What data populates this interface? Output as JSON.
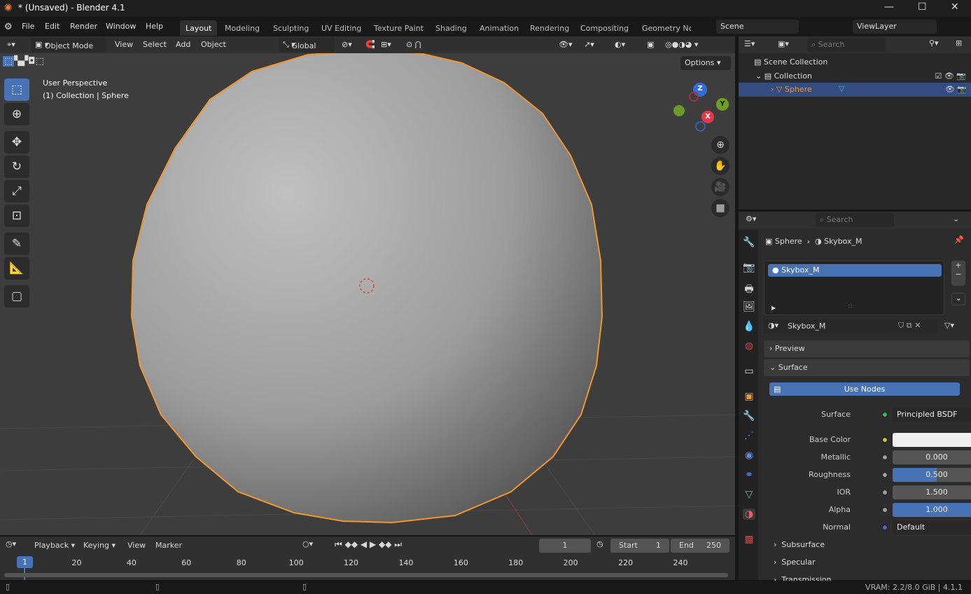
{
  "window": {
    "title": "* (Unsaved) - Blender 4.1",
    "minimize": "—",
    "maximize": "☐",
    "close": "✕"
  },
  "menu": {
    "items": [
      "File",
      "Edit",
      "Render",
      "Window",
      "Help"
    ],
    "workspaces": [
      "Layout",
      "Modeling",
      "Sculpting",
      "UV Editing",
      "Texture Paint",
      "Shading",
      "Animation",
      "Rendering",
      "Compositing",
      "Geometry Nc"
    ],
    "active_workspace": "Layout",
    "scene": "Scene",
    "view_layer": "ViewLayer"
  },
  "viewport": {
    "mode": "Object Mode",
    "menus": [
      "View",
      "Select",
      "Add",
      "Object"
    ],
    "orientation": "Global",
    "options": "Options",
    "overlay_title": "User Perspective",
    "overlay_subtitle": "(1) Collection | Sphere",
    "gizmo": {
      "x": "X",
      "y": "Y",
      "z": "Z"
    },
    "colors": {
      "selection": "#f0962e",
      "background": "#3d3d3d"
    }
  },
  "outliner": {
    "search_placeholder": "Search",
    "items": [
      {
        "label": "Scene Collection"
      },
      {
        "label": "Collection"
      },
      {
        "label": "Sphere"
      }
    ]
  },
  "properties": {
    "search_placeholder": "Search",
    "breadcrumb": [
      "Sphere",
      "Skybox_M"
    ],
    "slot": "Skybox_M",
    "material_name": "Skybox_M",
    "panels": {
      "preview": "Preview",
      "surface": "Surface"
    },
    "use_nodes": "Use Nodes",
    "surface_label": "Surface",
    "surface_value": "Principled BSDF",
    "inputs": [
      {
        "label": "Base Color",
        "value": "",
        "fraction": 0
      },
      {
        "label": "Metallic",
        "value": "0.000",
        "fraction": 0
      },
      {
        "label": "Roughness",
        "value": "0.500",
        "fraction": 0.5
      },
      {
        "label": "IOR",
        "value": "1.500",
        "fraction": 0
      },
      {
        "label": "Alpha",
        "value": "1.000",
        "fraction": 1
      }
    ],
    "normal_label": "Normal",
    "normal_value": "Default",
    "subpanels": [
      "Subsurface",
      "Specular",
      "Transmission"
    ],
    "accent": "#4772b3"
  },
  "timeline": {
    "menus": [
      "Playback",
      "Keying",
      "View",
      "Marker"
    ],
    "current_frame": "1",
    "start_label": "Start",
    "start": "1",
    "end_label": "End",
    "end": "250",
    "ticks": [
      "1",
      "20",
      "40",
      "60",
      "80",
      "100",
      "120",
      "140",
      "160",
      "180",
      "200",
      "220",
      "240"
    ]
  },
  "status": {
    "text": "VRAM: 2.2/8.0 GiB | 4.1.1"
  }
}
